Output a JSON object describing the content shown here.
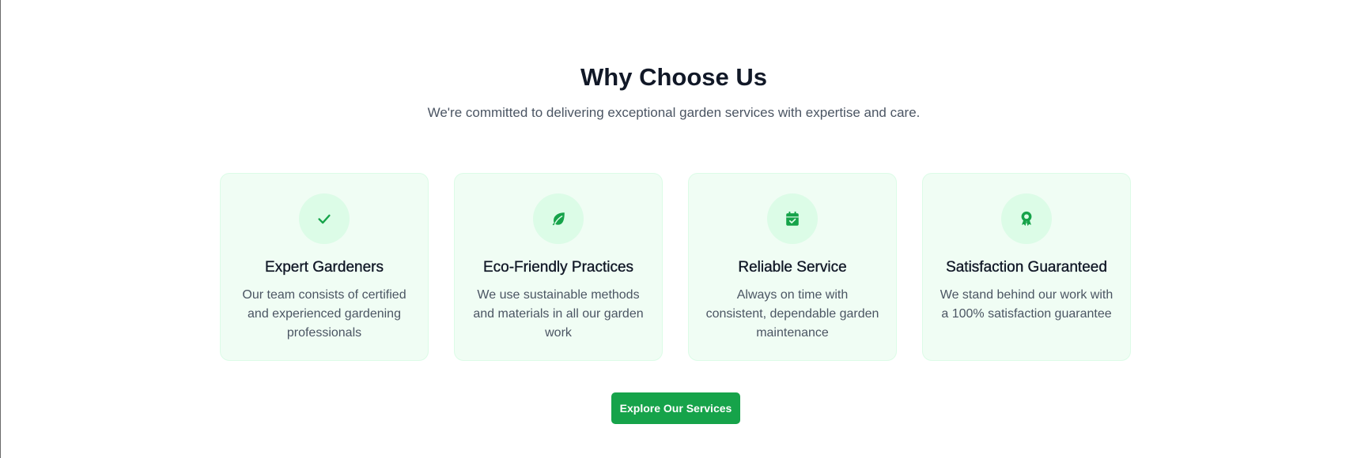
{
  "section": {
    "title": "Why Choose Us",
    "subtitle": "We're committed to delivering exceptional garden services with expertise and care."
  },
  "features": [
    {
      "icon": "check-icon",
      "title": "Expert Gardeners",
      "description": "Our team consists of certified and experienced gardening professionals"
    },
    {
      "icon": "leaf-icon",
      "title": "Eco-Friendly Practices",
      "description": "We use sustainable methods and materials in all our garden work"
    },
    {
      "icon": "calendar-check-icon",
      "title": "Reliable Service",
      "description": "Always on time with consistent, dependable garden maintenance"
    },
    {
      "icon": "award-icon",
      "title": "Satisfaction Guaranteed",
      "description": "We stand behind our work with a 100% satisfaction guarantee"
    }
  ],
  "cta": {
    "label": "Explore Our Services"
  },
  "colors": {
    "accent": "#16a34a",
    "card_background": "#f0fdf4",
    "icon_background": "#dcfce7",
    "heading": "#111827",
    "body_text": "#4b5563"
  }
}
